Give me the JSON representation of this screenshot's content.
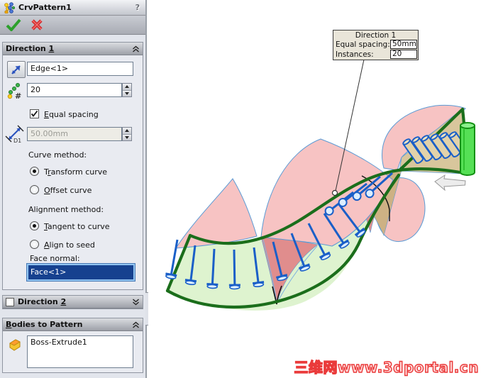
{
  "panel": {
    "title": "CrvPattern1",
    "help": "?",
    "dir1": {
      "header": "Direction 1",
      "edge_value": "Edge<1>",
      "instances_value": "20",
      "equal_spacing_label": "Equal spacing",
      "spacing_value": "50.00mm",
      "curve_method_label": "Curve method:",
      "transform_curve_label": "Transform curve",
      "offset_curve_label": "Offset curve",
      "alignment_method_label": "Alignment method:",
      "tangent_label": "Tangent to curve",
      "align_seed_label": "Align to seed",
      "face_normal_label": "Face normal:",
      "face_value": "Face<1>"
    },
    "dir2": {
      "header": "Direction 2"
    },
    "bodies": {
      "header": "Bodies to Pattern",
      "item": "Boss-Extrude1"
    }
  },
  "icons": {
    "d1_label": "D1",
    "hash_label": "#"
  },
  "viewport": {
    "callout": {
      "title": "Direction 1",
      "spacing_label": "Equal spacing:",
      "spacing_value": "50mm",
      "instances_label": "Instances:",
      "instances_value": "20"
    },
    "watermark": "三维网www.3dportal.cn"
  },
  "colors": {
    "accent_green": "#1b6e1b",
    "preview_blue": "#1a5fc8",
    "surface_pink": "#f7c3c3",
    "surface_green": "#def3cf",
    "surface_tan": "#d8c69c",
    "seed_highlight": "#55e055",
    "selection_navy": "#16418f",
    "watermark_red": "#ea3a3a"
  }
}
